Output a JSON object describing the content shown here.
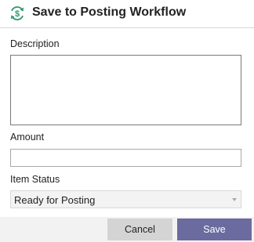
{
  "dialog": {
    "title": "Save to Posting Workflow",
    "icon": "dollar-refresh-icon",
    "accent_color": "#2e9a6a"
  },
  "fields": {
    "description": {
      "label": "Description",
      "value": ""
    },
    "amount": {
      "label": "Amount",
      "value": ""
    },
    "item_status": {
      "label": "Item Status",
      "selected": "Ready for Posting"
    }
  },
  "footer": {
    "cancel_label": "Cancel",
    "save_label": "Save",
    "save_color": "#6b6b9f"
  }
}
